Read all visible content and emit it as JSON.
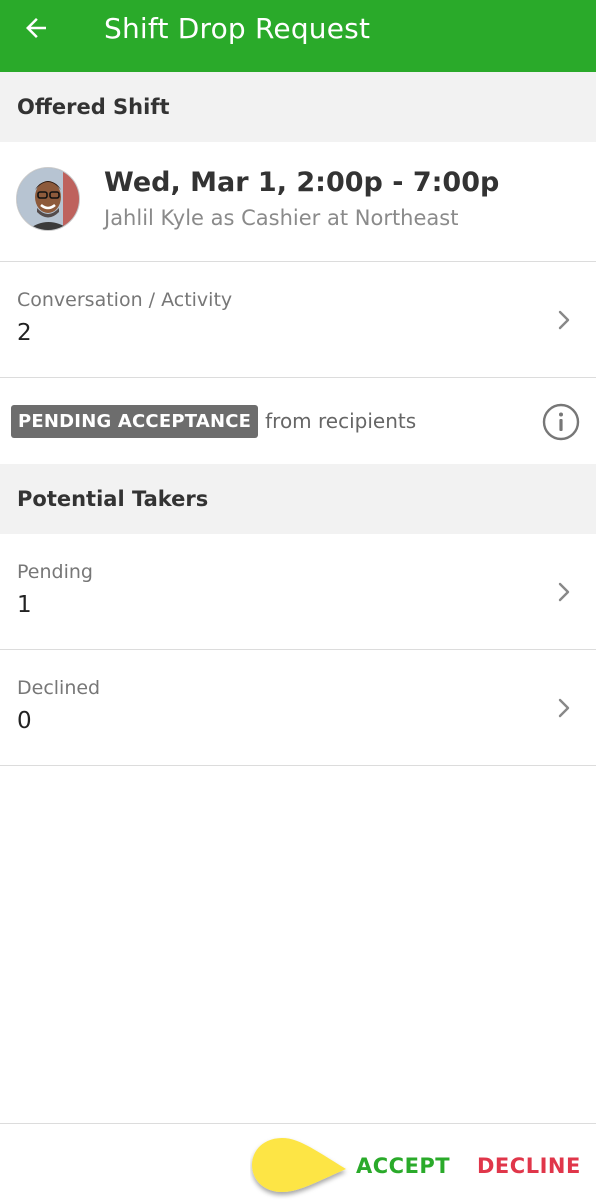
{
  "header": {
    "title": "Shift Drop Request",
    "back_icon": "arrow-left-icon",
    "color": "#2aaa2a"
  },
  "offered_section": {
    "label": "Offered Shift"
  },
  "shift": {
    "title": "Wed, Mar 1, 2:00p - 7:00p",
    "subtitle": "Jahlil Kyle as Cashier at Northeast",
    "avatar_icon": "user-avatar"
  },
  "conversation": {
    "label": "Conversation / Activity",
    "value": "2"
  },
  "status": {
    "badge": "PENDING ACCEPTANCE",
    "text": "from recipients",
    "info_icon": "info-icon"
  },
  "takers_section": {
    "label": "Potential Takers"
  },
  "pending": {
    "label": "Pending",
    "value": "1"
  },
  "declined": {
    "label": "Declined",
    "value": "0"
  },
  "actions": {
    "accept_label": "ACCEPT",
    "decline_label": "DECLINE",
    "accept_color": "#2aaa2a",
    "decline_color": "#e0364a"
  }
}
